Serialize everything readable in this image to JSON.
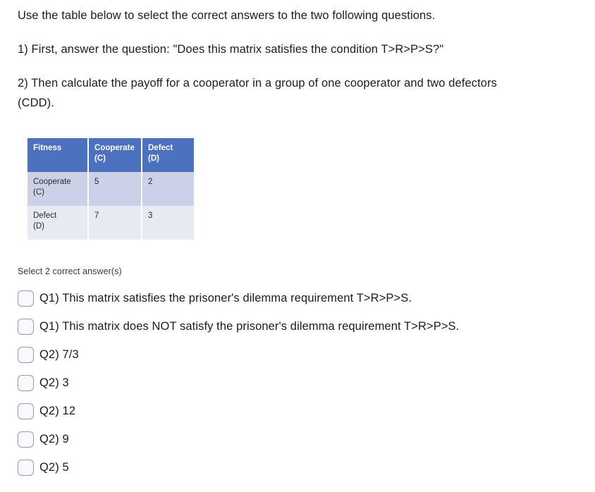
{
  "prompt": {
    "intro": "Use the table below to select the correct answers to the two following questions.",
    "question1": "1) First, answer the question: \"Does this matrix satisfies the condition T>R>P>S?\"",
    "question2": "2) Then calculate the payoff for a cooperator in a group of one cooperator and two defectors (CDD)."
  },
  "matrix": {
    "corner_label": "Fitness",
    "column_headers": [
      {
        "name": "Cooperate",
        "code": "(C)"
      },
      {
        "name": "Defect",
        "code": "(D)"
      }
    ],
    "rows": [
      {
        "name": "Cooperate",
        "code": "(C)",
        "values": [
          "5",
          "2"
        ]
      },
      {
        "name": "Defect",
        "code": "(D)",
        "values": [
          "7",
          "3"
        ]
      }
    ],
    "colors": {
      "header_background": "#4c71be",
      "header_text": "#ffffff",
      "row_a_background": "#ccd1e8",
      "row_b_background": "#e6eaf3",
      "grid_line": "#ffffff"
    }
  },
  "answers": {
    "select_hint": "Select 2 correct answer(s)",
    "options": [
      {
        "label": "Q1) This matrix satisfies the prisoner's dilemma requirement T>R>P>S.",
        "checked": false
      },
      {
        "label": "Q1) This matrix does NOT satisfy the prisoner's dilemma requirement T>R>P>S.",
        "checked": false
      },
      {
        "label": "Q2) 7/3",
        "checked": false
      },
      {
        "label": "Q2) 3",
        "checked": false
      },
      {
        "label": "Q2) 12",
        "checked": false
      },
      {
        "label": "Q2) 9",
        "checked": false
      },
      {
        "label": "Q2) 5",
        "checked": false
      }
    ]
  }
}
